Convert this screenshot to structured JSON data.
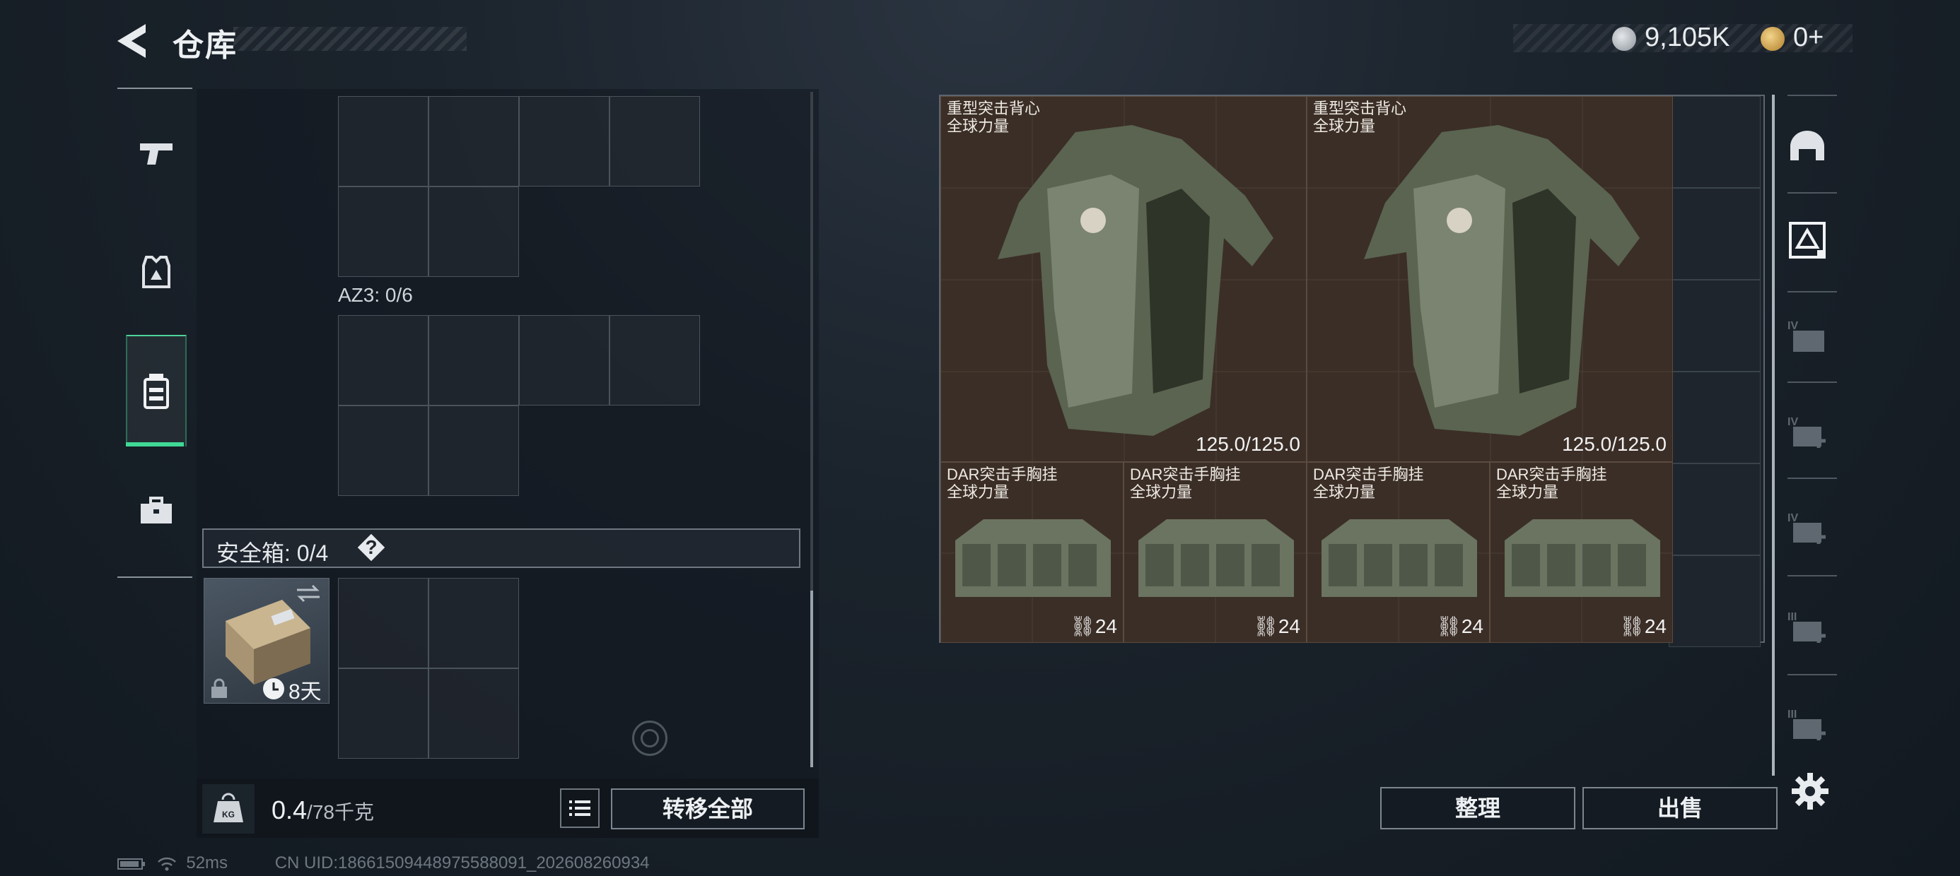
{
  "header": {
    "title": "仓库",
    "currency": [
      {
        "icon": "silver-coin-icon",
        "value": "9,105K"
      },
      {
        "icon": "gold-coin-icon",
        "value": "0+"
      }
    ]
  },
  "left_nav": {
    "items": [
      {
        "name": "weapon-tab",
        "icon": "pistol-icon"
      },
      {
        "name": "armor-tab",
        "icon": "vest-icon"
      },
      {
        "name": "backpack-tab",
        "icon": "backpack-icon",
        "active": true
      },
      {
        "name": "supplies-tab",
        "icon": "briefcase-icon"
      }
    ],
    "active_color": "#3fd895"
  },
  "loadout": {
    "az3_label": "AZ3: 0/6",
    "safebox_label": "安全箱: 0/4",
    "safebox_help": "?",
    "safebox_item_days": "8天",
    "weight_value": "0.4",
    "weight_max": "/78千克",
    "transfer_all": "转移全部"
  },
  "stash": {
    "items": [
      {
        "name": "重型突击背心",
        "sub": "全球力量",
        "durability": "125.0/125.0"
      },
      {
        "name": "重型突击背心",
        "sub": "全球力量",
        "durability": "125.0/125.0"
      },
      {
        "name": "DAR突击手胸挂",
        "sub": "全球力量",
        "capacity": "24"
      },
      {
        "name": "DAR突击手胸挂",
        "sub": "全球力量",
        "capacity": "24"
      },
      {
        "name": "DAR突击手胸挂",
        "sub": "全球力量",
        "capacity": "24"
      },
      {
        "name": "DAR突击手胸挂",
        "sub": "全球力量",
        "capacity": "24"
      }
    ],
    "organize": "整理",
    "sell": "出售"
  },
  "right_nav": {
    "items": [
      {
        "icon": "helmet-icon"
      },
      {
        "icon": "armor-level-icon",
        "active": true
      },
      {
        "icon": "tier-iv-folder-icon",
        "label": "IV"
      },
      {
        "icon": "tier-iv-medkit-icon",
        "label": "IV"
      },
      {
        "icon": "tier-iv-medkit-icon",
        "label": "IV"
      },
      {
        "icon": "tier-iii-medkit-icon",
        "label": "III"
      },
      {
        "icon": "tier-iii-medkit-icon",
        "label": "III"
      }
    ]
  },
  "status": {
    "ping": "52ms",
    "uid": "CN UID:18661509448975588091_202608260934"
  }
}
